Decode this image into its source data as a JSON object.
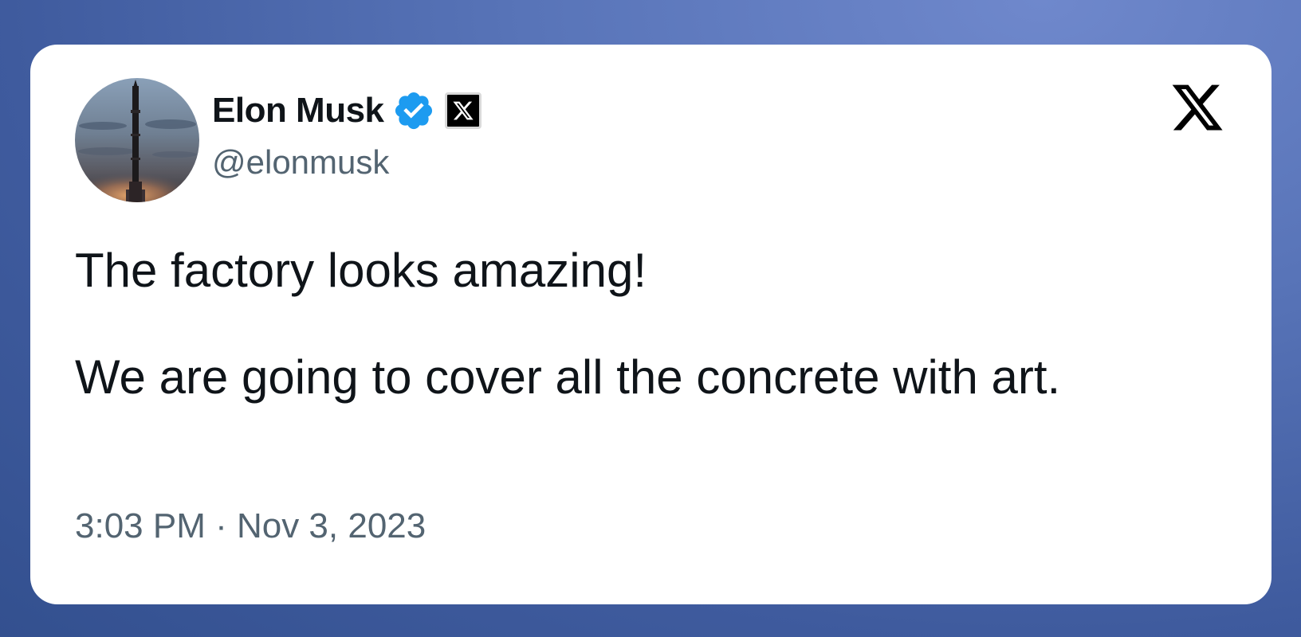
{
  "author": {
    "display_name": "Elon Musk",
    "handle": "@elonmusk",
    "avatar_icon": "rocket-launch-avatar",
    "verified_icon": "verified-badge-icon",
    "affiliation_icon": "x-affiliation-icon"
  },
  "brand": {
    "logo_icon": "x-logo-icon"
  },
  "tweet": {
    "lines": [
      "The factory looks amazing!",
      "We are going to cover all the concrete with art."
    ],
    "timestamp": "3:03 PM · Nov 3, 2023"
  },
  "colors": {
    "background": "#4a66aa",
    "card": "#ffffff",
    "text": "#0f1419",
    "muted": "#536471",
    "verified": "#1d9bf0"
  }
}
